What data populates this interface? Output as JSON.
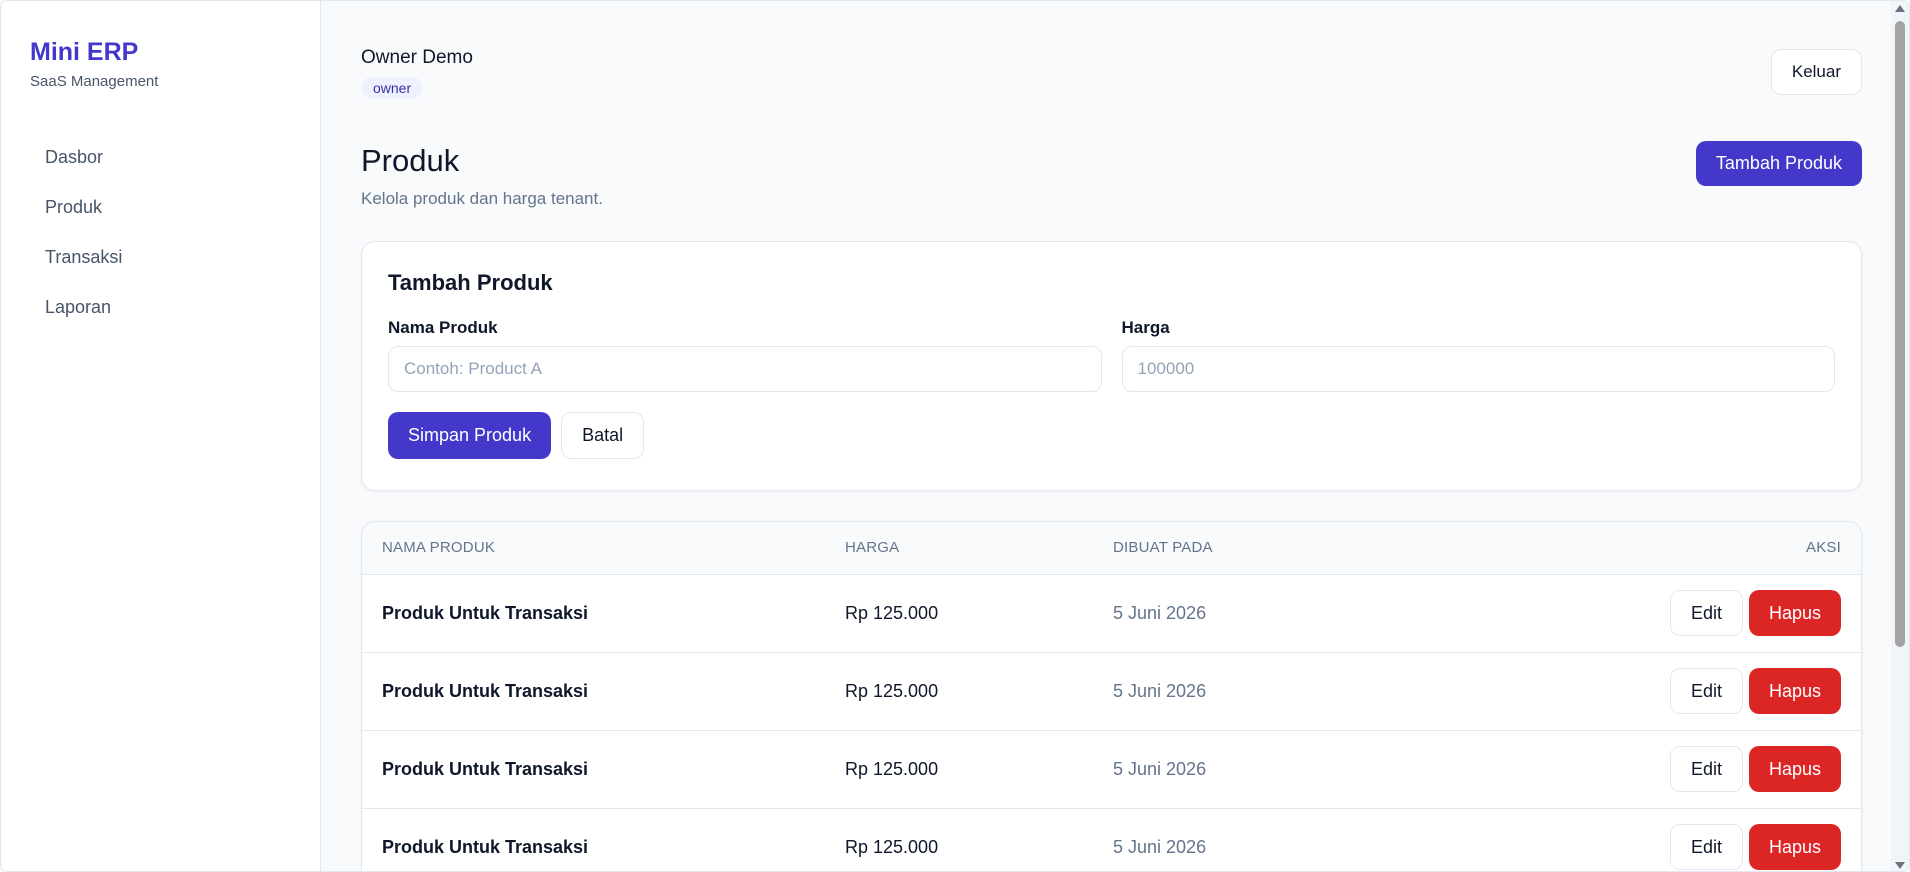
{
  "sidebar": {
    "brand_title": "Mini ERP",
    "brand_subtitle": "SaaS Management",
    "items": [
      {
        "label": "Dasbor"
      },
      {
        "label": "Produk"
      },
      {
        "label": "Transaksi"
      },
      {
        "label": "Laporan"
      }
    ]
  },
  "header": {
    "user_name": "Owner Demo",
    "role": "owner",
    "logout_label": "Keluar"
  },
  "page": {
    "title": "Produk",
    "subtitle": "Kelola produk dan harga tenant.",
    "add_button_label": "Tambah Produk"
  },
  "form": {
    "title": "Tambah Produk",
    "name_label": "Nama Produk",
    "name_placeholder": "Contoh: Product A",
    "name_value": "",
    "price_label": "Harga",
    "price_placeholder": "100000",
    "price_value": "",
    "save_label": "Simpan Produk",
    "cancel_label": "Batal"
  },
  "table": {
    "columns": [
      "NAMA PRODUK",
      "HARGA",
      "DIBUAT PADA",
      "AKSI"
    ],
    "edit_label": "Edit",
    "delete_label": "Hapus",
    "rows": [
      {
        "name": "Produk Untuk Transaksi",
        "price": "Rp 125.000",
        "created": "5 Juni 2026"
      },
      {
        "name": "Produk Untuk Transaksi",
        "price": "Rp 125.000",
        "created": "5 Juni 2026"
      },
      {
        "name": "Produk Untuk Transaksi",
        "price": "Rp 125.000",
        "created": "5 Juni 2026"
      },
      {
        "name": "Produk Untuk Transaksi",
        "price": "Rp 125.000",
        "created": "5 Juni 2026"
      }
    ]
  },
  "colors": {
    "accent": "#4338ca",
    "danger": "#dc2626",
    "text_primary": "#0f172a",
    "text_muted": "#64748b",
    "border": "#e2e8f0",
    "background": "#f8fafc"
  }
}
